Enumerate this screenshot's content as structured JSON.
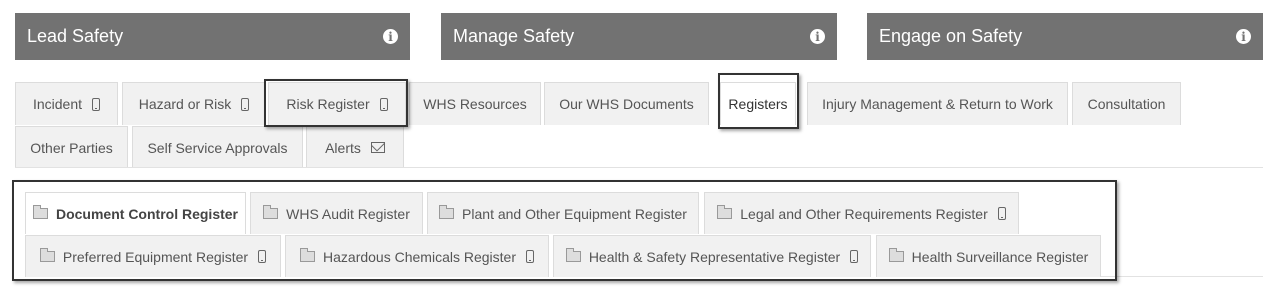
{
  "panels": [
    {
      "title": "Lead Safety",
      "icon": "info-icon"
    },
    {
      "title": "Manage Safety",
      "icon": "info-icon"
    },
    {
      "title": "Engage on Safety",
      "icon": "info-icon"
    }
  ],
  "main_tabs": {
    "row1": [
      {
        "label": "Incident",
        "icon": "mobile-icon"
      },
      {
        "label": "Hazard or Risk",
        "icon": "mobile-icon"
      },
      {
        "label": "Risk Register",
        "icon": "mobile-icon"
      },
      {
        "label": "WHS Resources"
      },
      {
        "label": "Our WHS Documents"
      },
      {
        "label": "Registers",
        "active": true
      },
      {
        "label": "Injury Management & Return to Work"
      },
      {
        "label": "Consultation"
      }
    ],
    "row2": [
      {
        "label": "Other Parties"
      },
      {
        "label": "Self Service Approvals"
      },
      {
        "label": "Alerts",
        "icon": "envelope-icon"
      }
    ]
  },
  "register_tabs": {
    "row1": [
      {
        "label": "Document Control Register",
        "icon": "folder-icon",
        "active": true
      },
      {
        "label": "WHS Audit Register",
        "icon": "folder-icon"
      },
      {
        "label": "Plant and Other Equipment Register",
        "icon": "folder-icon"
      },
      {
        "label": "Legal and Other Requirements Register",
        "icon": "folder-icon",
        "mobile": true
      }
    ],
    "row2": [
      {
        "label": "Preferred Equipment Register",
        "icon": "folder-icon",
        "mobile": true
      },
      {
        "label": "Hazardous Chemicals Register",
        "icon": "folder-icon",
        "mobile": true
      },
      {
        "label": "Health & Safety Representative Register",
        "icon": "folder-icon",
        "mobile": true
      },
      {
        "label": "Health Surveillance Register",
        "icon": "folder-icon"
      }
    ]
  },
  "colors": {
    "panel_bg": "#727272",
    "tab_bg": "#f1f1f1",
    "highlight_border": "#333333"
  }
}
